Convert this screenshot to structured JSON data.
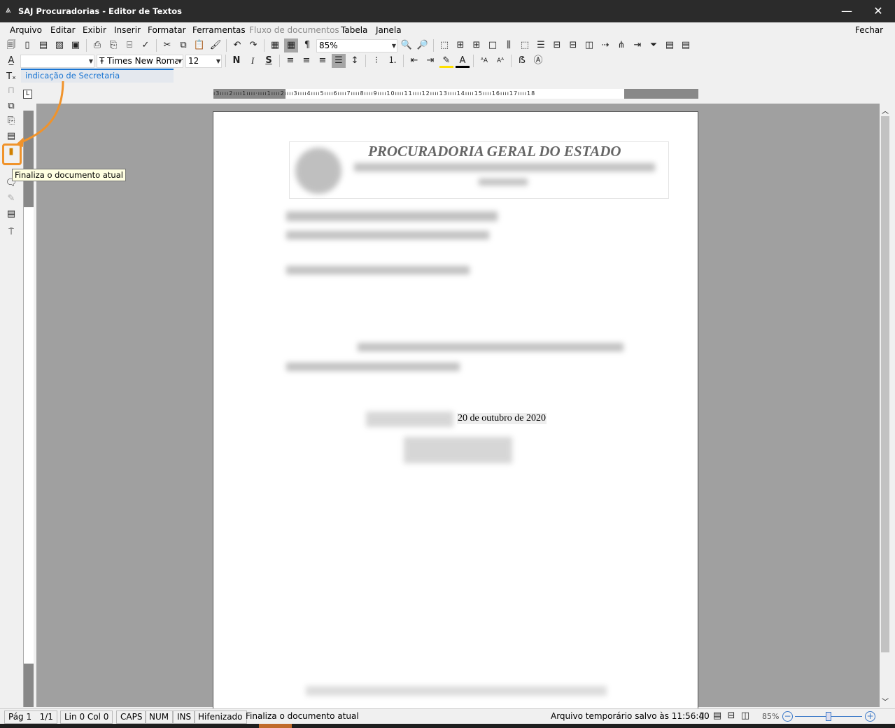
{
  "window": {
    "title": "SAJ Procuradorias - Editor de Textos",
    "minimize": "—",
    "close": "✕"
  },
  "menu": {
    "items": [
      "Arquivo",
      "Editar",
      "Exibir",
      "Inserir",
      "Formatar",
      "Ferramentas",
      "Fluxo de documentos",
      "Tabela",
      "Janela"
    ],
    "disabled_index": 6,
    "close_label": "Fechar"
  },
  "toolbar": {
    "zoom_value": "85%",
    "style_value": "",
    "font_value": "Times New Roman",
    "size_value": "12",
    "bold": "N",
    "italic": "I",
    "strike": "S"
  },
  "tab": {
    "label": "indicação de Secretaria"
  },
  "document": {
    "header_title": "PROCURADORIA GERAL DO ESTADO",
    "date_text": "20 de outubro de 2020"
  },
  "tooltip": {
    "text": "Finaliza o documento atual"
  },
  "status": {
    "page": "Pág 1",
    "pages": "1/1",
    "line_col": "Lin 0  Col 0",
    "caps": "CAPS",
    "num": "NUM",
    "ins": "INS",
    "hyphen": "Hifenizado",
    "message": "Finaliza o documento atual",
    "autosave": "Arquivo temporário salvo às 11:56:40",
    "zoom": "85%",
    "zoom_level": 0.5
  },
  "colors": {
    "accent": "#1874d2",
    "highlight": "#f0932b",
    "titlebar": "#2b2b2b"
  }
}
